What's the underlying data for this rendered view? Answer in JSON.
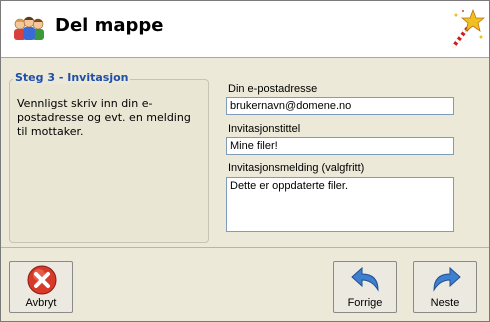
{
  "window": {
    "title": "Del mappe"
  },
  "step": {
    "title": "Steg 3 - Invitasjon",
    "description": "Vennligst skriv inn din e-postadresse og evt. en melding til mottaker."
  },
  "form": {
    "email_label": "Din e-postadresse",
    "email_value": "brukernavn@domene.no",
    "title_label": "Invitasjonstittel",
    "title_value": "Mine filer!",
    "message_label": "Invitasjonsmelding (valgfritt)",
    "message_value": "Dette er oppdaterte filer."
  },
  "buttons": {
    "cancel": "Avbryt",
    "back": "Forrige",
    "next": "Neste"
  },
  "icons": {
    "logo": "people-group-icon",
    "wizard": "magic-wand-icon",
    "cancel": "red-x-icon",
    "back": "back-arrow-icon",
    "next": "forward-arrow-icon"
  },
  "colors": {
    "accent": "#1f4fa8",
    "cancel_red": "#d83a2a",
    "arrow_blue": "#3f7fd0"
  }
}
